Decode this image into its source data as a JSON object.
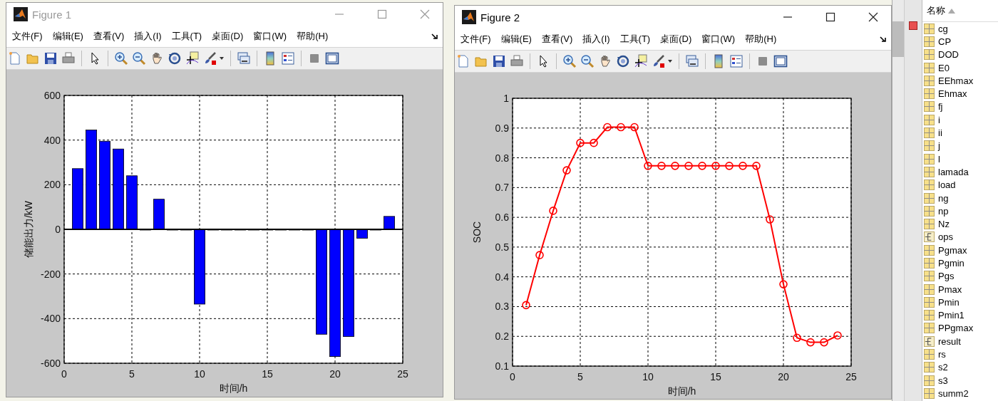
{
  "figures": [
    {
      "title": "Figure 1",
      "active": false,
      "menu": [
        "文件(F)",
        "编辑(E)",
        "查看(V)",
        "插入(I)",
        "工具(T)",
        "桌面(D)",
        "窗口(W)",
        "帮助(H)"
      ],
      "chart_data": {
        "type": "bar",
        "xlabel": "时间/h",
        "ylabel": "储能出力/kW",
        "grid": true,
        "x": [
          1,
          2,
          3,
          4,
          5,
          6,
          7,
          8,
          9,
          10,
          11,
          12,
          13,
          14,
          15,
          16,
          17,
          18,
          19,
          20,
          21,
          22,
          23,
          24
        ],
        "series": [
          {
            "color": "#0000ff",
            "values": [
              272,
              445,
              395,
              360,
              240,
              0,
              135,
              0,
              0,
              -335,
              0,
              0,
              0,
              0,
              0,
              0,
              0,
              0,
              -470,
              -570,
              -480,
              -40,
              0,
              58
            ]
          }
        ],
        "xlim": [
          0,
          25
        ],
        "ylim": [
          -600,
          600
        ],
        "xticks": [
          0,
          5,
          10,
          15,
          20,
          25
        ],
        "yticks": [
          -600,
          -400,
          -200,
          0,
          200,
          400,
          600
        ]
      }
    },
    {
      "title": "Figure 2",
      "active": true,
      "menu": [
        "文件(F)",
        "编辑(E)",
        "查看(V)",
        "插入(I)",
        "工具(T)",
        "桌面(D)",
        "窗口(W)",
        "帮助(H)"
      ],
      "chart_data": {
        "type": "line",
        "xlabel": "时间/h",
        "ylabel": "SOC",
        "grid": true,
        "x": [
          1,
          2,
          3,
          4,
          5,
          6,
          7,
          8,
          9,
          10,
          11,
          12,
          13,
          14,
          15,
          16,
          17,
          18,
          19,
          20,
          21,
          22,
          23,
          24
        ],
        "series": [
          {
            "color": "#ff0000",
            "marker": "o",
            "values": [
              0.305,
              0.473,
              0.622,
              0.758,
              0.85,
              0.85,
              0.903,
              0.903,
              0.903,
              0.773,
              0.773,
              0.773,
              0.773,
              0.773,
              0.773,
              0.773,
              0.773,
              0.773,
              0.593,
              0.375,
              0.195,
              0.18,
              0.18,
              0.203
            ]
          }
        ],
        "xlim": [
          0,
          25
        ],
        "ylim": [
          0.1,
          1
        ],
        "xticks": [
          0,
          5,
          10,
          15,
          20,
          25
        ],
        "yticks": [
          0.1,
          0.2,
          0.3,
          0.4,
          0.5,
          0.6,
          0.7,
          0.8,
          0.9,
          1
        ]
      }
    }
  ],
  "workspace": {
    "header": "名称",
    "items": [
      {
        "name": "cg",
        "kind": "matrix"
      },
      {
        "name": "CP",
        "kind": "matrix"
      },
      {
        "name": "DOD",
        "kind": "matrix"
      },
      {
        "name": "E0",
        "kind": "matrix"
      },
      {
        "name": "EEhmax",
        "kind": "matrix"
      },
      {
        "name": "Ehmax",
        "kind": "matrix"
      },
      {
        "name": "fj",
        "kind": "matrix"
      },
      {
        "name": "i",
        "kind": "matrix"
      },
      {
        "name": "ii",
        "kind": "matrix"
      },
      {
        "name": "j",
        "kind": "matrix"
      },
      {
        "name": "l",
        "kind": "matrix"
      },
      {
        "name": "lamada",
        "kind": "matrix"
      },
      {
        "name": "load",
        "kind": "matrix"
      },
      {
        "name": "ng",
        "kind": "matrix"
      },
      {
        "name": "np",
        "kind": "matrix"
      },
      {
        "name": "Nz",
        "kind": "matrix"
      },
      {
        "name": "ops",
        "kind": "struct"
      },
      {
        "name": "Pgmax",
        "kind": "matrix"
      },
      {
        "name": "Pgmin",
        "kind": "matrix"
      },
      {
        "name": "Pgs",
        "kind": "matrix"
      },
      {
        "name": "Pmax",
        "kind": "matrix"
      },
      {
        "name": "Pmin",
        "kind": "matrix"
      },
      {
        "name": "Pmin1",
        "kind": "matrix"
      },
      {
        "name": "PPgmax",
        "kind": "matrix"
      },
      {
        "name": "result",
        "kind": "struct"
      },
      {
        "name": "rs",
        "kind": "matrix"
      },
      {
        "name": "s2",
        "kind": "matrix"
      },
      {
        "name": "s3",
        "kind": "matrix"
      },
      {
        "name": "summ2",
        "kind": "matrix"
      }
    ]
  }
}
